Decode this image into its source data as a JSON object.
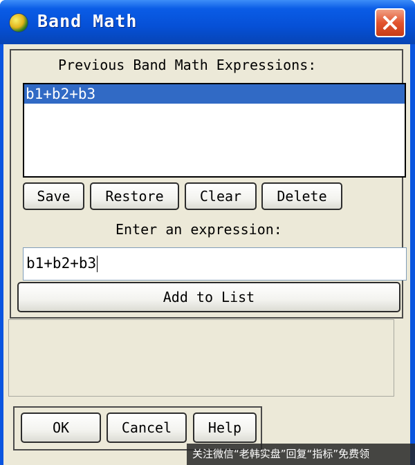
{
  "window": {
    "title": "Band Math",
    "close_label": "Close"
  },
  "history": {
    "label": "Previous Band Math Expressions:",
    "items": [
      "b1+b2+b3"
    ],
    "buttons": {
      "save": "Save",
      "restore": "Restore",
      "clear": "Clear",
      "delete": "Delete"
    }
  },
  "expression": {
    "label": "Enter an expression:",
    "value": "b1+b2+b3",
    "add_label": "Add to List"
  },
  "footer": {
    "ok": "OK",
    "cancel": "Cancel",
    "help": "Help"
  },
  "watermark": {
    "text": "关注微信“老韩实盘”回复“指标”免费领"
  },
  "colors": {
    "selection": "#316ac5",
    "titlebar": "#0a5ce6",
    "dialog_bg": "#ece9d8"
  }
}
